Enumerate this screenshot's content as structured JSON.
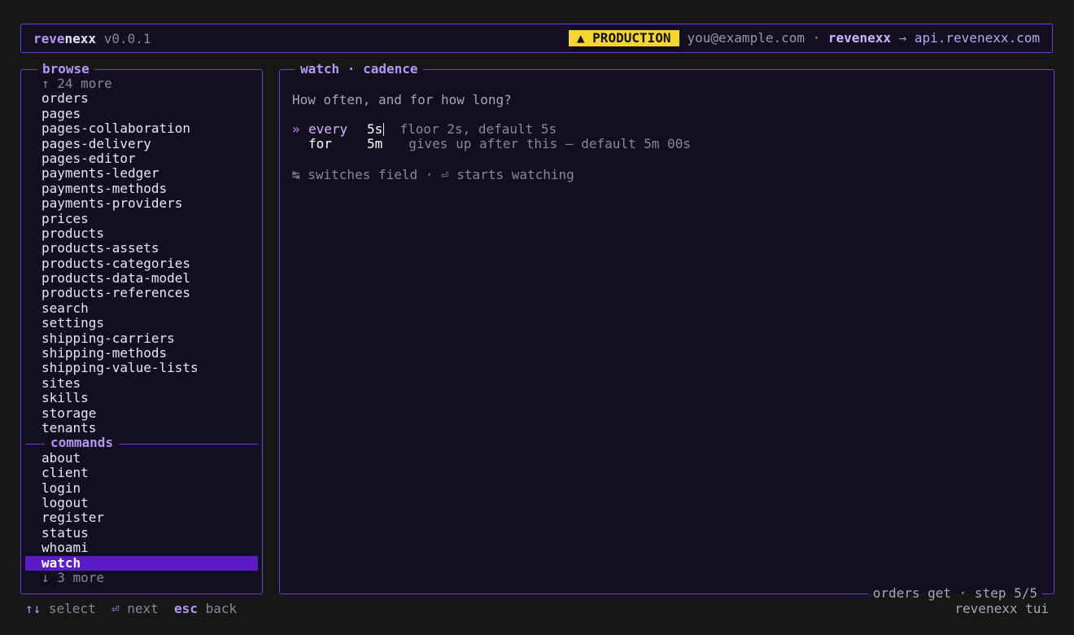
{
  "app": {
    "logo_part1": "reve",
    "logo_part2": "nexx",
    "version": "v0.0.1",
    "env_badge": "▲ PRODUCTION",
    "account": "you@example.com",
    "separator": " · ",
    "target_name": "revenexx",
    "arrow": " → ",
    "target_host": "api.revenexx.com"
  },
  "sidebar": {
    "browse_title": "browse",
    "more_above": "↑ 24 more",
    "browse_items": [
      "orders",
      "pages",
      "pages-collaboration",
      "pages-delivery",
      "pages-editor",
      "payments-ledger",
      "payments-methods",
      "payments-providers",
      "prices",
      "products",
      "products-assets",
      "products-categories",
      "products-data-model",
      "products-references",
      "search",
      "settings",
      "shipping-carriers",
      "shipping-methods",
      "shipping-value-lists",
      "sites",
      "skills",
      "storage",
      "tenants"
    ],
    "commands_title": "commands",
    "command_items": [
      "about",
      "client",
      "login",
      "logout",
      "register",
      "status",
      "whoami"
    ],
    "selected_item": "watch",
    "more_below": "↓ 3 more"
  },
  "main": {
    "title": "watch · cadence",
    "prompt": "How often, and for how long?",
    "fields": {
      "every": {
        "caret": "»",
        "label": "every",
        "value": "5s",
        "hint": "  floor 2s, default 5s"
      },
      "for": {
        "label": "for",
        "value": "5m",
        "hint": "gives up after this — default 5m 00s"
      }
    },
    "keyhint": "↹ switches field · ⏎ starts watching",
    "footer_note": "orders get · step 5/5"
  },
  "statusbar": {
    "k1": "↑↓",
    "t1": " select  ",
    "k2": "⏎",
    "t2": " next  ",
    "k3": "esc",
    "t3": " back",
    "right": "revenexx tui"
  },
  "colors": {
    "accent": "#6d3fd6",
    "selection": "#5b1bc7",
    "badge": "#f3d631",
    "panel_bg": "#130f21",
    "page_bg": "#171717"
  }
}
